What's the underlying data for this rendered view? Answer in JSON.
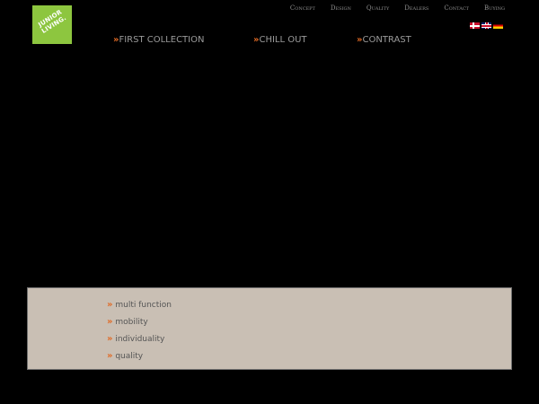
{
  "logo": {
    "line1": "JUNIOR",
    "line2": "LIVING."
  },
  "topnav": [
    "Concept",
    "Design",
    "Quality",
    "Dealers",
    "Contact",
    "Buying"
  ],
  "languages": [
    "danish-flag-icon",
    "uk-flag-icon",
    "german-flag-icon"
  ],
  "mainnav": [
    "FIRST COLLECTION",
    "CHILL OUT",
    "CONTRAST"
  ],
  "features": [
    "multi function",
    "mobility",
    "individuality",
    "quality"
  ],
  "bullet": "»",
  "colors": {
    "background": "#000000",
    "accent": "#e06a25",
    "logo": "#8dc63f",
    "panel": "#c9bfb4"
  }
}
